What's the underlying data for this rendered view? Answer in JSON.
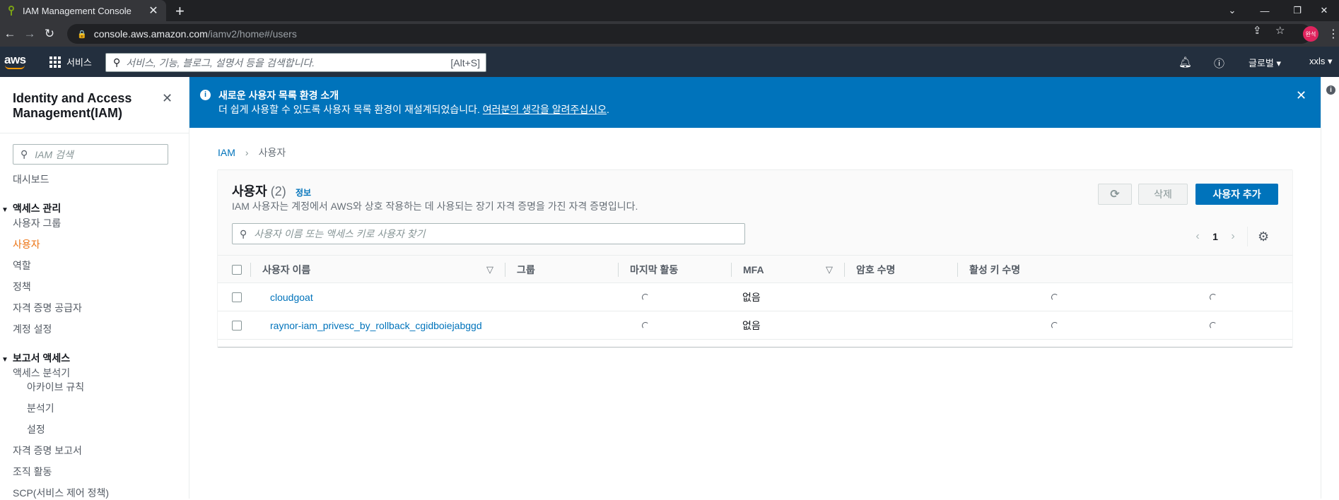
{
  "browser": {
    "tab_title": "IAM Management Console",
    "new_tab": "+",
    "url_host": "console.aws.amazon.com",
    "url_path": "/iamv2/home#/users",
    "profile_label": "완석"
  },
  "awsnav": {
    "logo": "aws",
    "services_label": "서비스",
    "search_placeholder": "서비스, 기능, 블로그, 설명서 등을 검색합니다.",
    "search_shortcut": "[Alt+S]",
    "region_label": "글로벌 ▾",
    "account_label": "xxls ▾"
  },
  "sidebar": {
    "title": "Identity and Access Management(IAM)",
    "search_placeholder": "IAM 검색",
    "dashboard": "대시보드",
    "access_mgmt_header": "액세스 관리",
    "access_items": [
      "사용자 그룹",
      "사용자",
      "역할",
      "정책",
      "자격 증명 공급자",
      "계정 설정"
    ],
    "report_header": "보고서 액세스",
    "report_items": [
      "액세스 분석기",
      "아카이브 규칙",
      "분석기",
      "설정",
      "자격 증명 보고서",
      "조직 활동",
      "SCP(서비스 제어 정책)"
    ]
  },
  "flash": {
    "title": "새로운 사용자 목록 환경 소개",
    "body": "더 쉽게 사용할 수 있도록 사용자 목록 환경이 재설계되었습니다. ",
    "link": "여러분의 생각을 알려주십시오",
    "suffix": "."
  },
  "breadcrumb": {
    "root": "IAM",
    "current": "사용자"
  },
  "users_panel": {
    "title": "사용자",
    "count": "(2)",
    "info_link": "정보",
    "description": "IAM 사용자는 계정에서 AWS와 상호 작용하는 데 사용되는 장기 자격 증명을 가진 자격 증명입니다.",
    "delete_label": "삭제",
    "add_label": "사용자 추가",
    "search_placeholder": "사용자 이름 또는 액세스 키로 사용자 찾기",
    "page": "1",
    "columns": [
      "사용자 이름",
      "그룹",
      "마지막 활동",
      "MFA",
      "암호 수명",
      "활성 키 수명"
    ],
    "rows": [
      {
        "username": "cloudgoat",
        "mfa": "없음"
      },
      {
        "username": "raynor-iam_privesc_by_rollback_cgidboiejabggd",
        "mfa": "없음"
      }
    ]
  },
  "colors": {
    "aws_nav": "#232f3e",
    "primary": "#0073bb",
    "active_orange": "#ec7211",
    "flash_blue": "#0073bb"
  }
}
